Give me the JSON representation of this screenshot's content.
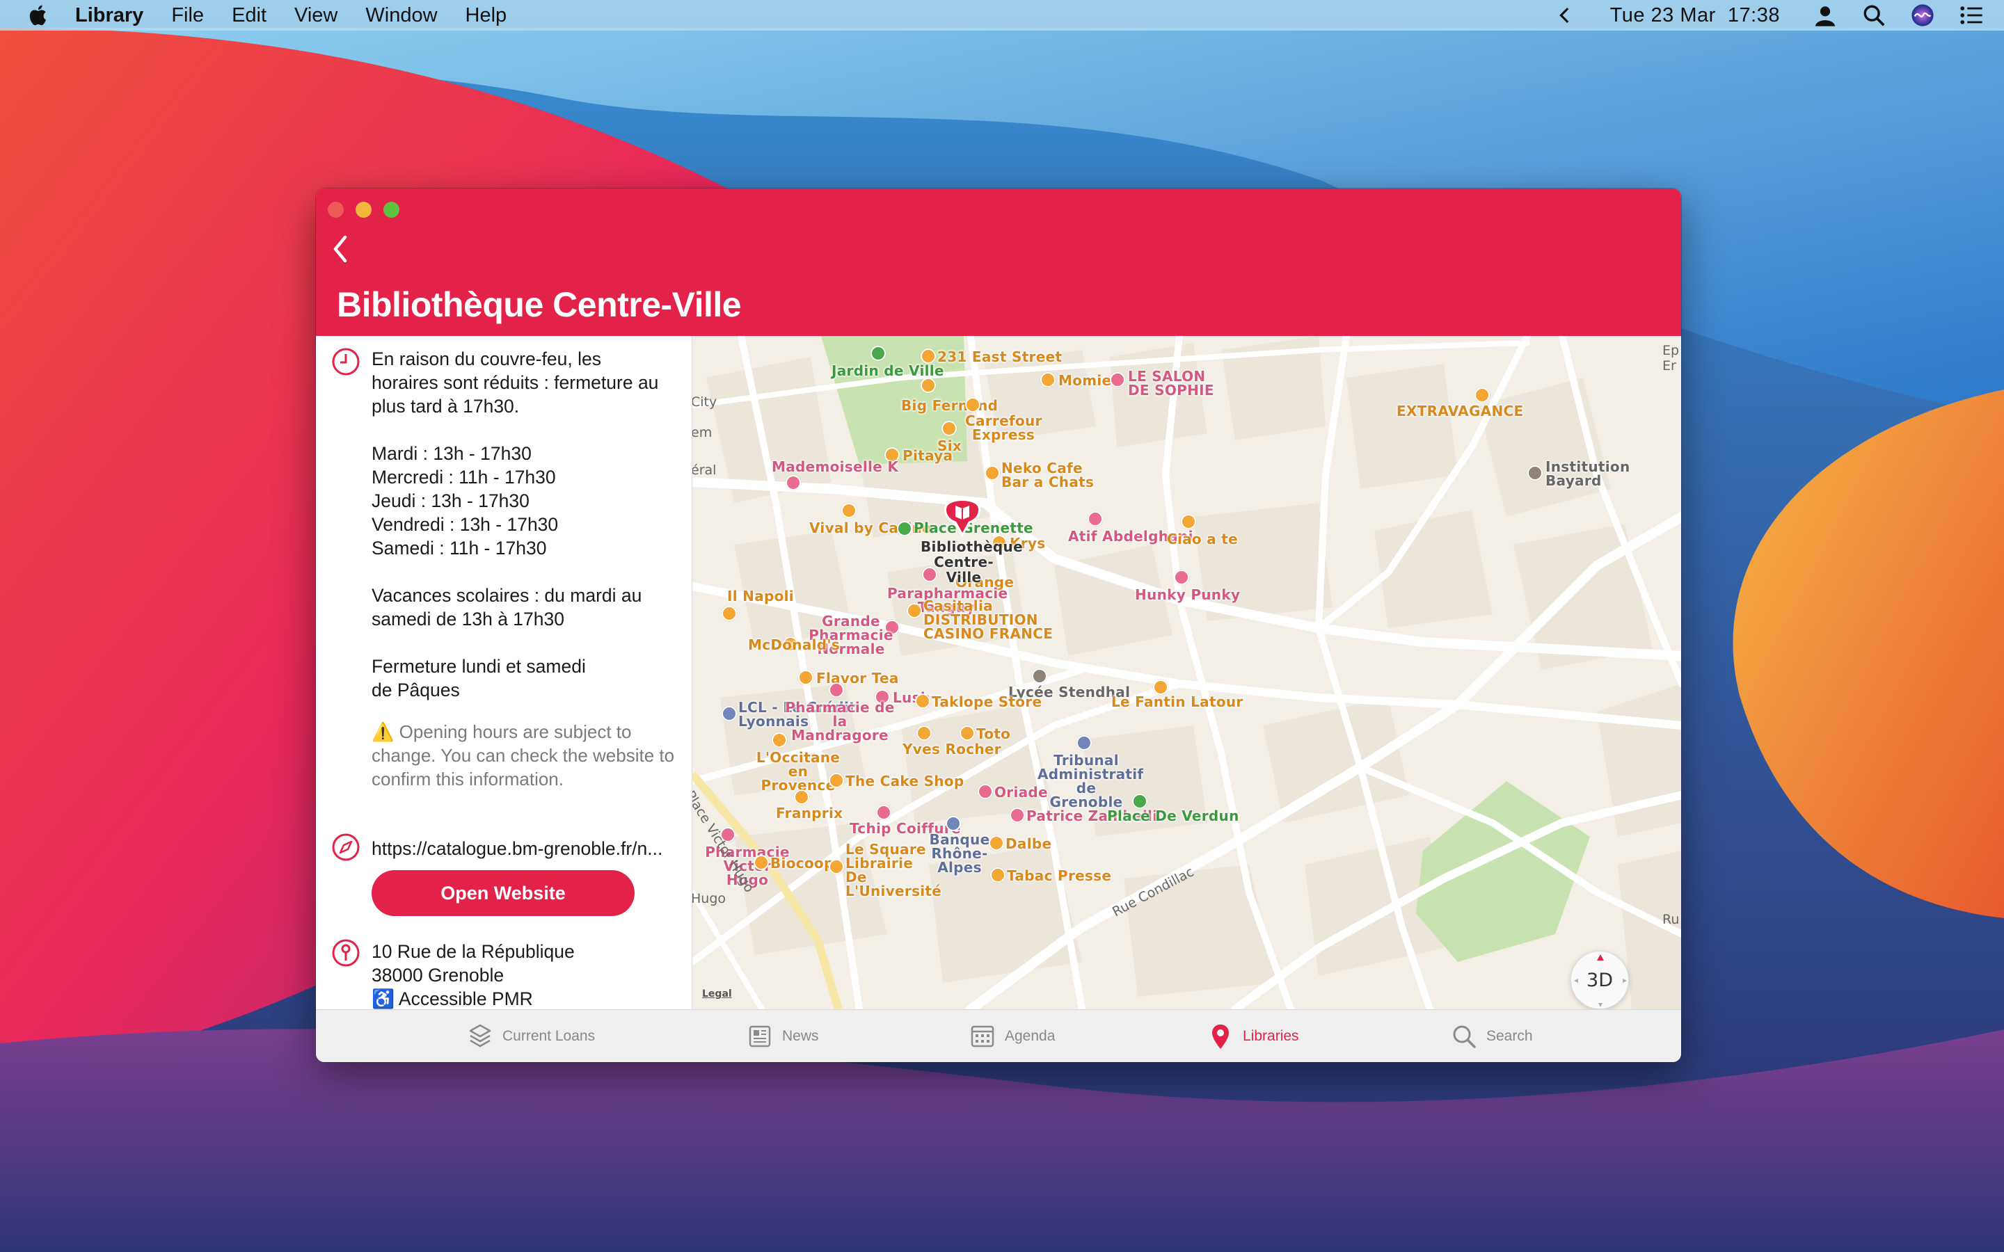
{
  "menubar": {
    "app_name": "Library",
    "menus": [
      "File",
      "Edit",
      "View",
      "Window",
      "Help"
    ],
    "clock": "Tue 23 Mar  17:38"
  },
  "window": {
    "title": "Bibliothèque Centre-Ville"
  },
  "info": {
    "notice_lines": [
      "En raison du couvre-feu, les",
      "horaires sont réduits : fermeture au",
      "plus tard à 17h30."
    ],
    "hours": [
      "Mardi : 13h - 17h30",
      "Mercredi : 11h - 17h30",
      "Jeudi : 13h - 17h30",
      "Vendredi : 13h - 17h30",
      "Samedi : 11h - 17h30"
    ],
    "holidays_lines": [
      "Vacances scolaires : du mardi au",
      "samedi de 13h à 17h30"
    ],
    "closure_lines": [
      "Fermeture lundi et samedi",
      "de Pâques"
    ],
    "warning_text": "⚠️ Opening hours are subject to change. You can check the website to confirm this information.",
    "website_url": "https://catalogue.bm-grenoble.fr/n...",
    "open_website_label": "Open Website",
    "address_lines": [
      "10 Rue de la République",
      "38000 Grenoble"
    ],
    "accessibility": "♿ Accessible PMR"
  },
  "map": {
    "library_pin_label": "Bibliothèque\nCentre-Ville",
    "legal_label": "Legal",
    "button_3d": "3D",
    "places": [
      {
        "name": "Jardin de Ville",
        "kind": "green"
      },
      {
        "name": "231 East Street",
        "kind": "orange"
      },
      {
        "name": "Big Fernand",
        "kind": "orange"
      },
      {
        "name": "Carrefour Express",
        "kind": "orange"
      },
      {
        "name": "Momie",
        "kind": "orange"
      },
      {
        "name": "LE SALON DE SOPHIE",
        "kind": "pink"
      },
      {
        "name": "EXTRAVAGANCE",
        "kind": "orange"
      },
      {
        "name": "Six",
        "kind": "orange"
      },
      {
        "name": "Pitaya",
        "kind": "orange"
      },
      {
        "name": "Mademoiselle K",
        "kind": "pink"
      },
      {
        "name": "Neko Cafe Bar a Chats",
        "kind": "orange"
      },
      {
        "name": "Institution Bayard",
        "kind": "gray"
      },
      {
        "name": "Vival by Casino",
        "kind": "orange"
      },
      {
        "name": "Place Grenette",
        "kind": "green"
      },
      {
        "name": "Krys",
        "kind": "orange"
      },
      {
        "name": "Atif Abdelghani",
        "kind": "pink"
      },
      {
        "name": "Ciao a te",
        "kind": "orange"
      },
      {
        "name": "Orange",
        "kind": "orange"
      },
      {
        "name": "Parapharmacie Tanguy",
        "kind": "pink"
      },
      {
        "name": "Hunky Punky",
        "kind": "pink"
      },
      {
        "name": "Il Napoli",
        "kind": "orange"
      },
      {
        "name": "Casitalia DISTRIBUTION CASINO FRANCE",
        "kind": "orange"
      },
      {
        "name": "Grande Pharmacie Normale",
        "kind": "pink"
      },
      {
        "name": "McDonald's",
        "kind": "orange"
      },
      {
        "name": "Flavor Tea",
        "kind": "orange"
      },
      {
        "name": "Lycée Stendhal",
        "kind": "gray"
      },
      {
        "name": "Le Fantin Latour",
        "kind": "orange"
      },
      {
        "name": "Lush",
        "kind": "pink"
      },
      {
        "name": "Taklope Store",
        "kind": "orange"
      },
      {
        "name": "LCL - Le Crédit Lyonnais",
        "kind": "blue"
      },
      {
        "name": "Pharmacie de la Mandragore",
        "kind": "pink"
      },
      {
        "name": "Yves Rocher",
        "kind": "orange"
      },
      {
        "name": "Toto",
        "kind": "orange"
      },
      {
        "name": "L'Occitane en Provence",
        "kind": "orange"
      },
      {
        "name": "Tribunal Administratif de Grenoble",
        "kind": "blue"
      },
      {
        "name": "The Cake Shop",
        "kind": "orange"
      },
      {
        "name": "Franprix",
        "kind": "orange"
      },
      {
        "name": "Oriade",
        "kind": "pink"
      },
      {
        "name": "Tchip Coiffure",
        "kind": "pink"
      },
      {
        "name": "Patrice Zambelli",
        "kind": "pink"
      },
      {
        "name": "Place De Verdun",
        "kind": "green"
      },
      {
        "name": "Banque Rhône-Alpes",
        "kind": "blue"
      },
      {
        "name": "Dalbe",
        "kind": "orange"
      },
      {
        "name": "Pharmacie Victor Hugo",
        "kind": "pink"
      },
      {
        "name": "Biocoop",
        "kind": "orange"
      },
      {
        "name": "Le Square Librairie De L'Université",
        "kind": "orange"
      },
      {
        "name": "Tabac Presse",
        "kind": "orange"
      }
    ],
    "streets": [
      "Place Victor Hugo",
      "Rue Condillac",
      "City",
      "em",
      "éral",
      "Hugo",
      "Ep",
      "Er",
      "Ru"
    ]
  },
  "tabs": [
    {
      "label": "Current Loans",
      "icon": "stack-icon"
    },
    {
      "label": "News",
      "icon": "newspaper-icon"
    },
    {
      "label": "Agenda",
      "icon": "calendar-icon"
    },
    {
      "label": "Libraries",
      "icon": "map-pin-icon",
      "active": true
    },
    {
      "label": "Search",
      "icon": "search-icon"
    }
  ],
  "colors": {
    "accent": "#e3224a"
  }
}
